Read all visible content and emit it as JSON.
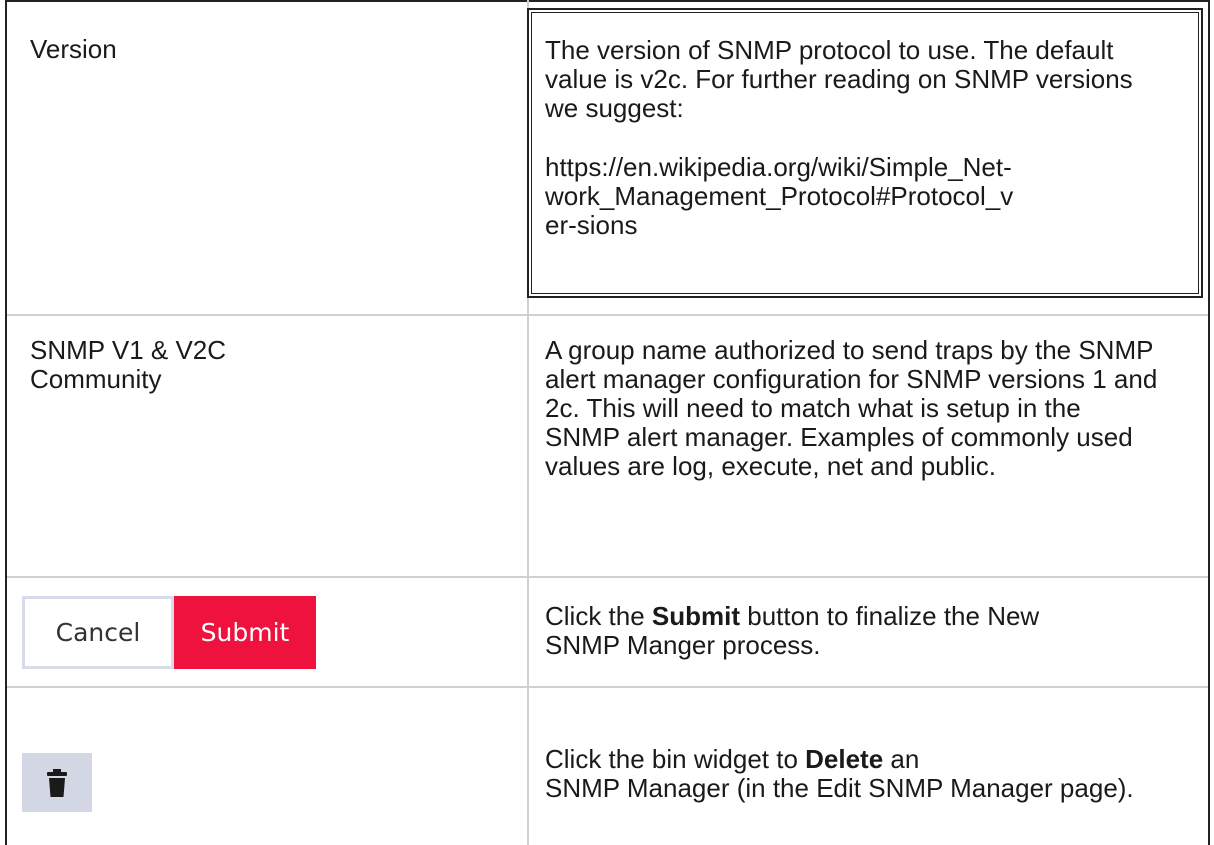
{
  "rows": [
    {
      "label": "Version",
      "description_p1": "The version of SNMP protocol to use. The default value is v2c. For further reading on SNMP versions we suggest:",
      "description_link": "https://en.wikipedia.org/wiki/Simple_Net-work_Management_Protocol#Protocol_ver-sions"
    },
    {
      "label_line1": "SNMP V1 & V2C",
      "label_line2": "Community",
      "description": "A group name authorized to send traps by the SNMP alert manager configuration for SNMP versions 1 and 2c. This will need to match what is setup in the SNMP alert manager. Examples of commonly used values are log, execute, net and public."
    },
    {
      "cancel_label": "Cancel",
      "submit_label": "Submit",
      "desc_prefix": "Click the ",
      "desc_bold": "Submit",
      "desc_suffix": " button to finalize the New SNMP Manger process."
    },
    {
      "icon": "trash-bin-icon",
      "desc_prefix": "Click the bin widget to ",
      "desc_bold": "Delete",
      "desc_mid": " an",
      "desc_suffix": "SNMP Manager (in the Edit SNMP Manager page)."
    }
  ],
  "colors": {
    "submit_bg": "#f0123e",
    "cancel_border": "#d8dcea",
    "bin_bg": "#d3d6e3"
  }
}
